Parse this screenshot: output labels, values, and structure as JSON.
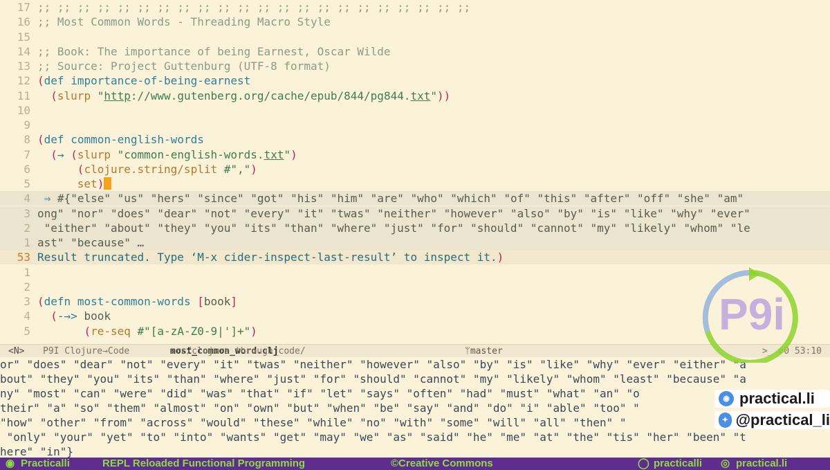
{
  "editor": {
    "lines": [
      {
        "ln": "17",
        "cls": "",
        "html": "<span class='comment'>;; ;; ;; ;; ;; ;; ;; ;; ;; ;; ;; ;; ;; ;; ;; ;; ;; ;; ;; ;; ;; ;;</span>"
      },
      {
        "ln": "16",
        "cls": "",
        "html": "<span class='comment'>;; Most Common Words - Threading Macro Style</span>"
      },
      {
        "ln": "15",
        "cls": "",
        "html": ""
      },
      {
        "ln": "14",
        "cls": "",
        "html": "<span class='comment'>;; Book: The importance of being Earnest, Oscar Wilde</span>"
      },
      {
        "ln": "13",
        "cls": "",
        "html": "<span class='comment'>;; Source: Project Guttenburg (UTF-8 format)</span>"
      },
      {
        "ln": "12",
        "cls": "",
        "html": "<span class='paren'>(</span><span class='kw'>def</span> <span class='sym'>importance-of-being-earnest</span>"
      },
      {
        "ln": "11",
        "cls": "",
        "html": "  <span class='paren'>(</span><span class='fn'>slurp</span> <span class='str'>\"<span class='url'>http</span>://www.gutenberg.org/cache/epub/844/pg844.<span class='url'>txt</span>\"</span><span class='paren'>))</span>"
      },
      {
        "ln": "10",
        "cls": "",
        "html": ""
      },
      {
        "ln": "9",
        "cls": "",
        "html": ""
      },
      {
        "ln": "8",
        "cls": "",
        "html": "<span class='paren'>(</span><span class='kw'>def</span> <span class='sym'>common-english-words</span>"
      },
      {
        "ln": "7",
        "cls": "",
        "html": "  <span class='paren'>(</span><span class='kw'>→</span> <span class='paren'>(</span><span class='fn'>slurp</span> <span class='str'>\"common-english-words.<span class='url'>txt</span>\"</span><span class='paren'>)</span>"
      },
      {
        "ln": "6",
        "cls": "",
        "html": "      <span class='paren'>(</span><span class='fn'>clojure.string/split</span> <span class='str'>#\",\"</span><span class='paren'>)</span>"
      },
      {
        "ln": "5",
        "cls": "",
        "html": "      <span class='fn'>set</span><span class='paren'>)</span><span class='cursor'></span>"
      },
      {
        "ln": "4",
        "cls": "hl",
        "html": " <span class='kw'>⇒</span> <span class='txt'>#{\"else\" \"us\" \"hers\" \"since\" \"got\" \"his\" \"him\" \"are\" \"who\" \"which\" \"of\" \"this\" \"after\" \"off\" \"she\" \"am\"</span>"
      },
      {
        "ln": "3",
        "cls": "hl",
        "html": "<span class='txt'>ong\" \"nor\" \"does\" \"dear\" \"not\" \"every\" \"it\" \"twas\" \"neither\" \"however\" \"also\" \"by\" \"is\" \"like\" \"why\" \"ever\"</span>"
      },
      {
        "ln": "2",
        "cls": "hl",
        "html": "<span class='txt'> \"either\" \"about\" \"they\" \"you\" \"its\" \"than\" \"where\" \"just\" \"for\" \"should\" \"cannot\" \"my\" \"likely\" \"whom\" \"le</span>"
      },
      {
        "ln": "1",
        "cls": "hl",
        "html": "<span class='txt'>ast\" \"because\" …</span>"
      },
      {
        "ln": "53",
        "cls": "cur",
        "html": "<span class='result'>Result truncated. Type ‘M-x cider-inspect-last-result’ to inspect it.</span><span class='paren'>)</span>"
      },
      {
        "ln": "1",
        "cls": "",
        "html": ""
      },
      {
        "ln": "2",
        "cls": "",
        "html": ""
      },
      {
        "ln": "3",
        "cls": "",
        "html": "<span class='paren'>(</span><span class='kw'>defn</span> <span class='sym'>most-common-words</span> <span class='paren'>[</span><span class='txt'>book</span><span class='paren'>]</span>"
      },
      {
        "ln": "4",
        "cls": "",
        "html": "  <span class='paren'>(</span><span class='kw'>-→&gt;</span> <span class='txt'>book</span>"
      },
      {
        "ln": "5",
        "cls": "",
        "html": "       <span class='paren'>(</span><span class='fn'>re-seq</span> <span class='str'>#\"[a-zA-Z0-9|']+\"</span><span class='paren'>)</span>"
      }
    ]
  },
  "modeline": {
    "mode": "<N>",
    "project": "P9I Clojure→Code",
    "path_prefix": "src/clojure_through_code/",
    "filename": "most_common_word.clj",
    "branch": "master",
    "right": ">_   ⊘0   53:10"
  },
  "repl": {
    "lines": [
      "or\" \"does\" \"dear\" \"not\" \"every\" \"it\" \"twas\" \"neither\" \"however\" \"also\" \"by\" \"is\" \"like\" \"why\" \"ever\" \"either\" \"a",
      "bout\" \"they\" \"you\" \"its\" \"than\" \"where\" \"just\" \"for\" \"should\" \"cannot\" \"my\" \"likely\" \"whom\" \"least\" \"because\" \"a",
      "ny\" \"most\" \"can\" \"were\" \"did\" \"was\" \"that\" \"if\" \"let\" \"says\" \"often\" \"had\" \"must\" \"what\" \"an\" \"o",
      "their\" \"a\" \"so\" \"them\" \"almost\" \"on\" \"own\" \"but\" \"when\" \"be\" \"say\" \"and\" \"do\" \"i\" \"able\" \"too\" \"",
      "\"how\" \"other\" \"from\" \"across\" \"would\" \"these\" \"while\" \"no\" \"with\" \"some\" \"will\" \"all\" \"then\" \"",
      " \"only\" \"your\" \"yet\" \"to\" \"into\" \"wants\" \"get\" \"may\" \"we\" \"as\" \"said\" \"he\" \"me\" \"at\" \"the\" \"tis\" \"her\" \"been\" \"t",
      "here\" \"in\"}"
    ]
  },
  "branding": {
    "site": "practical.li",
    "handle": "@practical_li",
    "logo_text": "P9i"
  },
  "footer": {
    "brand": "Practicalli",
    "title": "REPL Reloaded Functional Programming",
    "license": "©Creative Commons",
    "github": "practicalli",
    "web": "practical.li"
  }
}
